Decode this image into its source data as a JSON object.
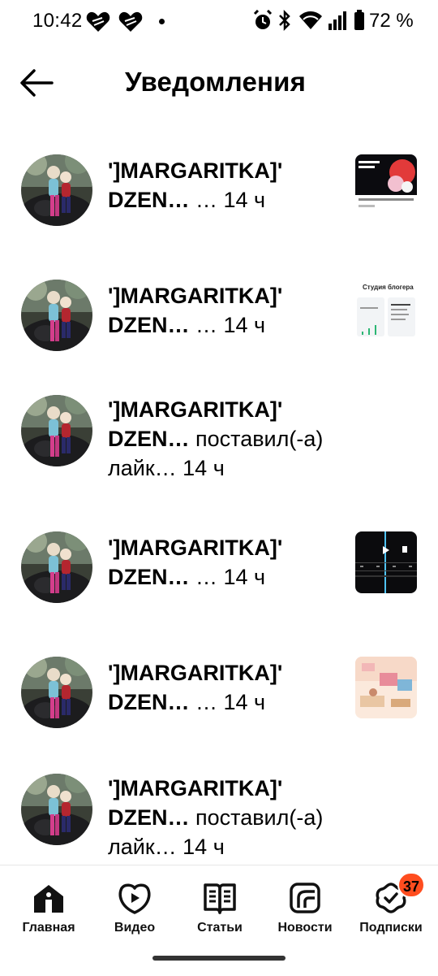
{
  "status_bar": {
    "time": "10:42",
    "battery_text": "72 %",
    "icons": [
      "heart-icon",
      "heart-icon",
      "dot-icon",
      "alarm-icon",
      "bluetooth-icon",
      "wifi-icon",
      "signal-icon",
      "battery-icon"
    ]
  },
  "header": {
    "back_icon": "arrow-left-icon",
    "title": "Уведомления"
  },
  "notifications": [
    {
      "name_line1": "']MARGARITKA]'",
      "name_line2": "DZEN…",
      "meta": " … 14 ч",
      "line3": "",
      "thumbnail": "video-thumb-pomidor"
    },
    {
      "name_line1": "']MARGARITKA]'",
      "name_line2": "DZEN…",
      "meta": " … 14 ч",
      "line3": "",
      "thumbnail": "studio-thumb"
    },
    {
      "name_line1": "']MARGARITKA]'",
      "name_line2": "DZEN…",
      "meta": " поставил(-а)",
      "line3": "лайк… 14 ч",
      "thumbnail": ""
    },
    {
      "name_line1": "']MARGARITKA]'",
      "name_line2": "DZEN…",
      "meta": " … 14 ч",
      "line3": "",
      "thumbnail": "video-editor-thumb"
    },
    {
      "name_line1": "']MARGARITKA]'",
      "name_line2": "DZEN…",
      "meta": " … 14 ч",
      "line3": "",
      "thumbnail": "room-illustration-thumb"
    },
    {
      "name_line1": "']MARGARITKA]'",
      "name_line2": "DZEN…",
      "meta": " поставил(-а)",
      "line3": "лайк… 14 ч",
      "thumbnail": ""
    }
  ],
  "thumbnail_texts": {
    "studio_title": "Студия блогера"
  },
  "bottom_nav": {
    "items": [
      {
        "label": "Главная",
        "icon": "home-icon"
      },
      {
        "label": "Видео",
        "icon": "video-play-icon"
      },
      {
        "label": "Статьи",
        "icon": "book-icon"
      },
      {
        "label": "Новости",
        "icon": "news-icon"
      },
      {
        "label": "Подписки",
        "icon": "subscriptions-icon"
      }
    ],
    "subscriptions_badge": "37"
  },
  "colors": {
    "badge": "#ff4d1f",
    "text": "#000000",
    "background": "#ffffff"
  }
}
